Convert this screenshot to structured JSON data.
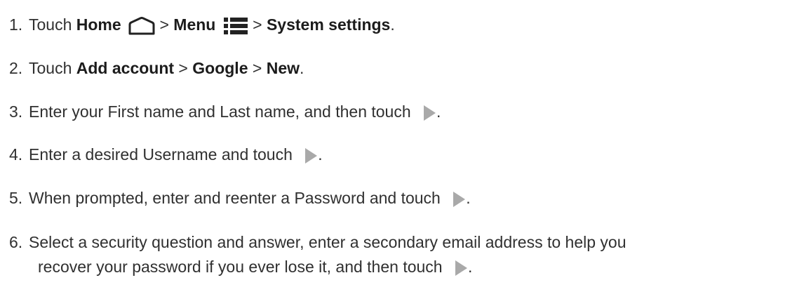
{
  "steps": [
    {
      "number": "1.",
      "parts": [
        "Touch ",
        "Home",
        " > ",
        "Menu",
        " > ",
        "System settings",
        "."
      ]
    },
    {
      "number": "2.",
      "parts": [
        "Touch ",
        "Add account",
        " > ",
        "Google",
        " > ",
        "New",
        "."
      ]
    },
    {
      "number": "3.",
      "parts": [
        "Enter your First name and Last name, and then touch ",
        "."
      ]
    },
    {
      "number": "4.",
      "parts": [
        "Enter a desired Username and touch ",
        "."
      ]
    },
    {
      "number": "5.",
      "parts": [
        "When prompted, enter and reenter a Password and touch ",
        "."
      ]
    },
    {
      "number": "6.",
      "line1": "Select a security question and answer, enter a secondary email address to help you",
      "line2_parts": [
        "recover your password if you ever lose it, and then touch ",
        "."
      ]
    }
  ],
  "icons": {
    "home": "home-icon",
    "menu": "menu-icon",
    "next": "next-arrow-icon"
  },
  "colors": {
    "text": "#303030",
    "icon_gray": "#a9a9a9",
    "icon_dark": "#222222"
  }
}
